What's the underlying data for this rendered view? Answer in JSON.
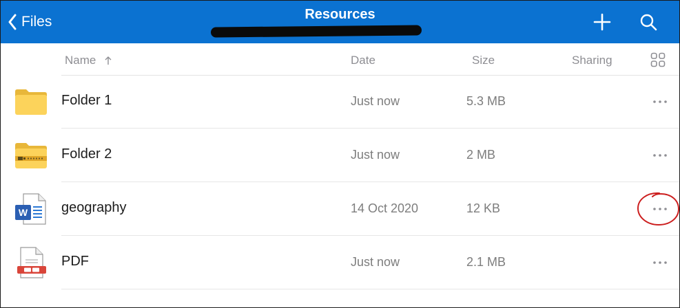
{
  "header": {
    "back_label": "Files",
    "title": "Resources",
    "bar_color": "#0b72d1"
  },
  "columns": {
    "name": "Name",
    "date": "Date",
    "size": "Size",
    "sharing": "Sharing"
  },
  "sort": {
    "column": "Name",
    "direction": "ascending"
  },
  "files": [
    {
      "name": "Folder 1",
      "date": "Just now",
      "size": "5.3 MB",
      "icon": "folder-icon"
    },
    {
      "name": "Folder 2",
      "date": "Just now",
      "size": "2 MB",
      "icon": "zip-folder-icon"
    },
    {
      "name": "geography",
      "date": "14 Oct 2020",
      "size": "12 KB",
      "icon": "word-document-icon"
    },
    {
      "name": "PDF",
      "date": "Just now",
      "size": "2.1 MB",
      "icon": "pdf-document-icon"
    }
  ],
  "annotation": {
    "target": "geography more options",
    "color": "#cc1f1f"
  }
}
